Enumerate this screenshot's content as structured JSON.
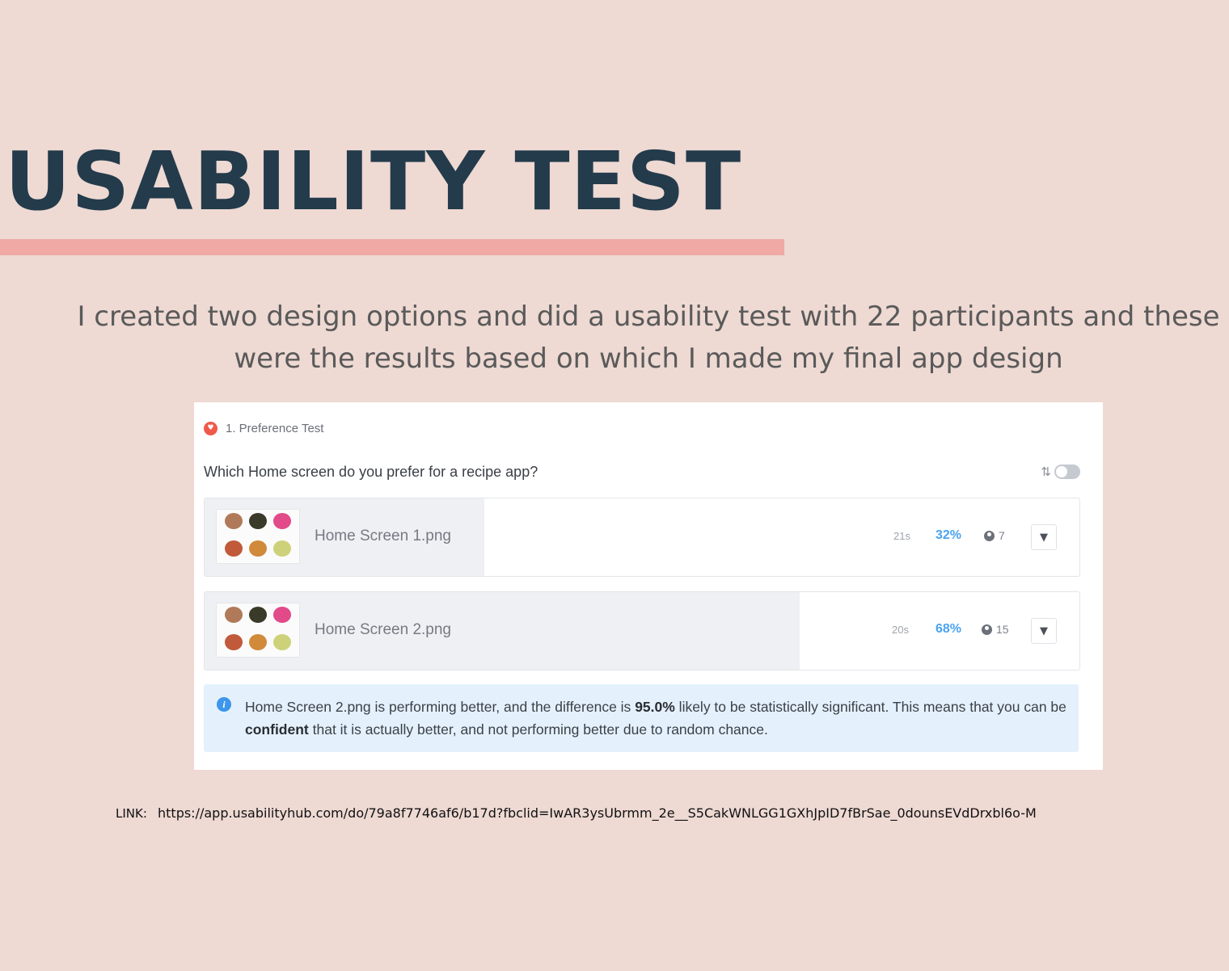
{
  "title": "USABILITY TEST",
  "intro": "I created two design options and did a usability test with 22 participants and these were the results based on which I made my final app design",
  "card": {
    "preference_label": "1. Preference Test",
    "question": "Which Home screen do you prefer for a recipe app?",
    "options": [
      {
        "name": "Home Screen 1.png",
        "time": "21s",
        "percent": "32%",
        "share": 0.32,
        "count": "7"
      },
      {
        "name": "Home Screen 2.png",
        "time": "20s",
        "percent": "68%",
        "share": 0.68,
        "count": "15"
      }
    ],
    "info": {
      "part1": "Home Screen 2.png is performing better, and the difference is ",
      "bold1": "95.0%",
      "part2": " likely to be statistically significant. This means that you can be ",
      "bold2": "confident",
      "part3": " that it is actually better, and not performing better due to random chance."
    }
  },
  "link": {
    "label": "LINK:",
    "url": "https://app.usabilityhub.com/do/79a8f7746af6/b17d?fbclid=IwAR3ysUbrmm_2e__S5CakWNLGG1GXhJpID7fBrSae_0dounsEVdDrxbl6o-M"
  },
  "colors": {
    "background": "#eed9d3",
    "title": "#233b4b",
    "underline": "#f0a9a4",
    "percent": "#4aa3f0",
    "info_bg": "#e4f1fc"
  },
  "icons": [
    "heart-icon",
    "sort-icon",
    "person-icon",
    "filter-icon",
    "info-icon"
  ]
}
